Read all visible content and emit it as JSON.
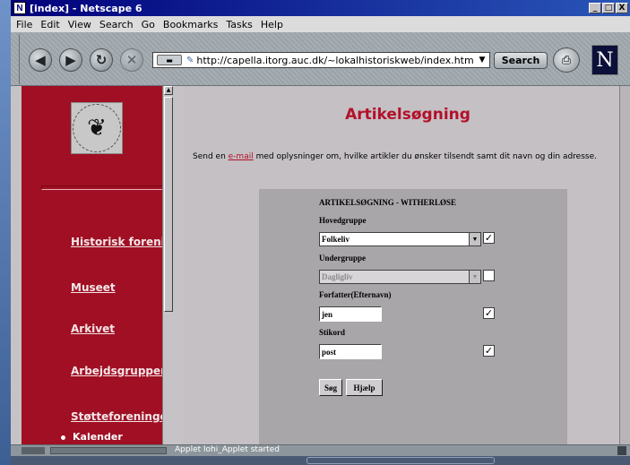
{
  "window": {
    "title": "[index] - Netscape 6",
    "app_icon": "N",
    "controls": [
      "_",
      "□",
      "X"
    ]
  },
  "menu": [
    "File",
    "Edit",
    "View",
    "Search",
    "Go",
    "Bookmarks",
    "Tasks",
    "Help"
  ],
  "toolbar": {
    "url": "http://capella.itorg.auc.dk/~lokalhistoriskweb/index.htm",
    "search_label": "Search",
    "logo_letter": "N"
  },
  "sidebar": {
    "items": [
      {
        "label": "Historisk forening"
      },
      {
        "label": "Museet"
      },
      {
        "label": "Arkivet"
      },
      {
        "label": "Arbejdsgrupper"
      },
      {
        "label": "Støtteforeninger"
      }
    ],
    "sub_item": "Kalender"
  },
  "main": {
    "heading": "Artikelsøgning",
    "intro_prefix": "Send en ",
    "intro_link": "e-mail",
    "intro_suffix": " med oplysninger om, hvilke artikler du ønsker tilsendt samt dit navn og din adresse.",
    "form": {
      "title": "ARTIKELSØGNING - WITHERLØSE",
      "hovedgruppe_label": "Hovedgruppe",
      "hovedgruppe_value": "Folkeliv",
      "hovedgruppe_checked": true,
      "undergruppe_label": "Undergruppe",
      "undergruppe_value": "Dagligliv",
      "undergruppe_checked": false,
      "forfatter_label": "Forfatter(Efternavn)",
      "forfatter_value": "jen",
      "forfatter_checked": true,
      "stikord_label": "Stikord",
      "stikord_value": "post",
      "stikord_checked": true,
      "search_button": "Søg",
      "help_button": "Hjælp"
    }
  },
  "status": {
    "message": "Applet lohi_Applet started"
  }
}
